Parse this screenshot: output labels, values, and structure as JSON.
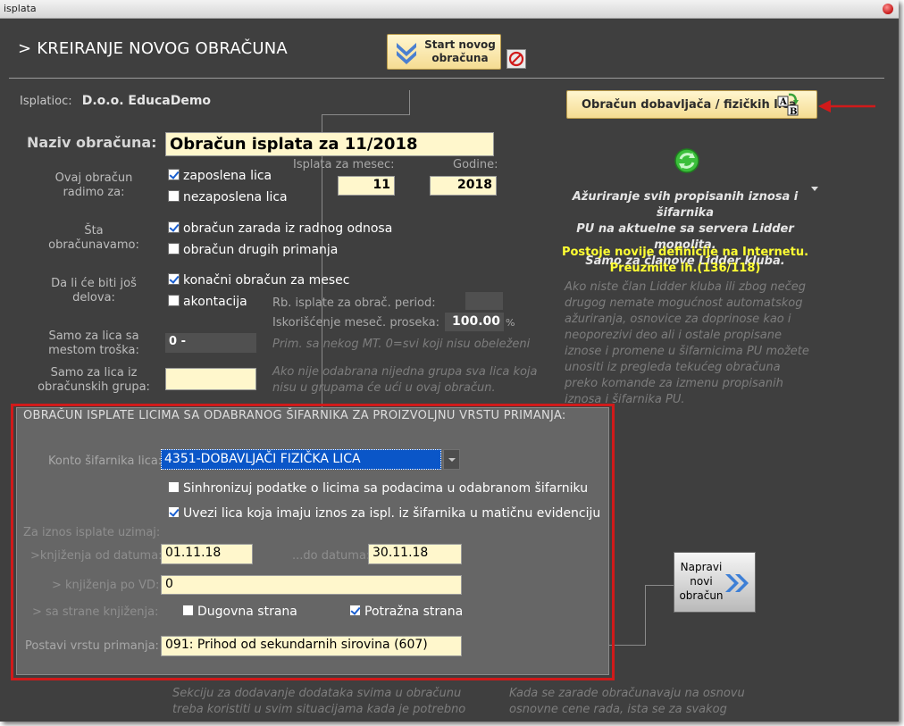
{
  "window": {
    "title": "isplata"
  },
  "header": {
    "title": "> KREIRANJE NOVOG OBRAČUNA",
    "start_button_line1": "Start novog",
    "start_button_line2": "obračuna"
  },
  "payer": {
    "label": "Isplatioc:",
    "value": "D.o.o. EducaDemo"
  },
  "calc_name": {
    "label": "Naziv obračuna:",
    "value": "Obračun isplata za 11/2018"
  },
  "for_whom": {
    "label_line1": "Ovaj obračun",
    "label_line2": "radimo za:",
    "opt_employed": "zaposlena lica",
    "opt_employed_checked": true,
    "opt_unemployed": "nezaposlena lica",
    "opt_unemployed_checked": false
  },
  "period": {
    "month_label": "Isplata za mesec:",
    "month_value": "11",
    "year_label": "Godine:",
    "year_value": "2018"
  },
  "what": {
    "label_line1": "Šta",
    "label_line2": "obračunavamo:",
    "opt_salary": "obračun zarada iz radnog odnosa",
    "opt_salary_checked": true,
    "opt_other": "obračun drugih primanja",
    "opt_other_checked": false
  },
  "parts": {
    "label_line1": "Da li će biti još",
    "label_line2": "delova:",
    "opt_final": "konačni obračun za mesec",
    "opt_final_checked": true,
    "opt_advance": "akontacija",
    "opt_advance_checked": false,
    "rb_label": "Rb. isplate za obrač. period:",
    "rb_value": "",
    "usage_label": "Iskorišćenje meseč. proseka:",
    "usage_value": "100.00",
    "usage_unit": "%"
  },
  "cost_center": {
    "label_line1": "Samo za lica sa",
    "label_line2": "mestom troška:",
    "value": "0 -",
    "hint": "Prim. sa nekog MT. 0=svi koji nisu obeleženi"
  },
  "groups": {
    "label_line1": "Samo za lica iz",
    "label_line2": "obračunskih grupa:",
    "value": "",
    "hint_line1": "Ako nije odabrana nijedna grupa sva lica koja",
    "hint_line2": "nisu u grupama će ući u ovaj obračun."
  },
  "right_panel": {
    "contractor_button": "Obračun dobavljača / fizičkih lica",
    "update_line1": "Ažuriranje svih propisanih iznosa i šifarnika",
    "update_line2": "PU na aktuelne sa servera Lidder monolita.",
    "update_line3": "Samo za članove Lidder kluba.",
    "new_def_line1": "Postoje novije definicije na Internetu.",
    "new_def_line2": "Preuzmite ih.(136/118)",
    "info_line1": "Ako niste član Lidder kluba ili zbog nečeg",
    "info_line2": "drugog nemate mogućnost automatskog",
    "info_line3": "ažuriranja, osnovice za doprinose kao i",
    "info_line4": "neoporezivi deo ali i ostale propisane",
    "info_line5": "iznose i promene u šifarnicima PU možete",
    "info_line6": "unositi iz pregleda tekućeg obračuna",
    "info_line7": "preko komande za izmenu propisanih",
    "info_line8": "iznosa i šifarnika PU."
  },
  "section": {
    "title": "OBRAČUN ISPLATE LICIMA SA ODABRANOG ŠIFARNIKA ZA PROIZVOLJNU VRSTU PRIMANJA:",
    "konto_label": "Konto šifarnika lica:",
    "konto_value": "4351-DOBAVLJAČI FIZIČKA LICA",
    "sync_label": "Sinhronizuj podatke o licima sa podacima u odabranom šifarniku",
    "sync_checked": false,
    "link_label": "Uvezi lica koja imaju iznos za ispl. iz šifarnika u matičnu evidenciju",
    "link_checked": true,
    "amount_label": "Za iznos isplate uzimaj:",
    "from_label": ">knjiženja od datuma:",
    "from_value": "01.11.18",
    "to_label": "...do datuma:",
    "to_value": "30.11.18",
    "vd_label": "> knjiženja po VD:",
    "vd_value": "0",
    "side_label": "> sa strane knjiženja:",
    "debit_label": "Dugovna strana",
    "debit_checked": false,
    "credit_label": "Potražna strana",
    "credit_checked": true,
    "type_label": "Postavi vrstu primanja:",
    "type_value": "091: Prihod od sekundarnih sirovina (607)"
  },
  "make_button": {
    "line1": "Napravi",
    "line2": "novi",
    "line3": "obračun"
  },
  "bottom": {
    "left_line1": "Sekciju za dodavanje dodataka svima u obračunu",
    "left_line2": "treba koristiti u svim situacijama kada je potrebno",
    "right_line1": "Kada se zarade obračunavaju na osnovu",
    "right_line2": "osnovne cene rada, ista se za svakog"
  }
}
